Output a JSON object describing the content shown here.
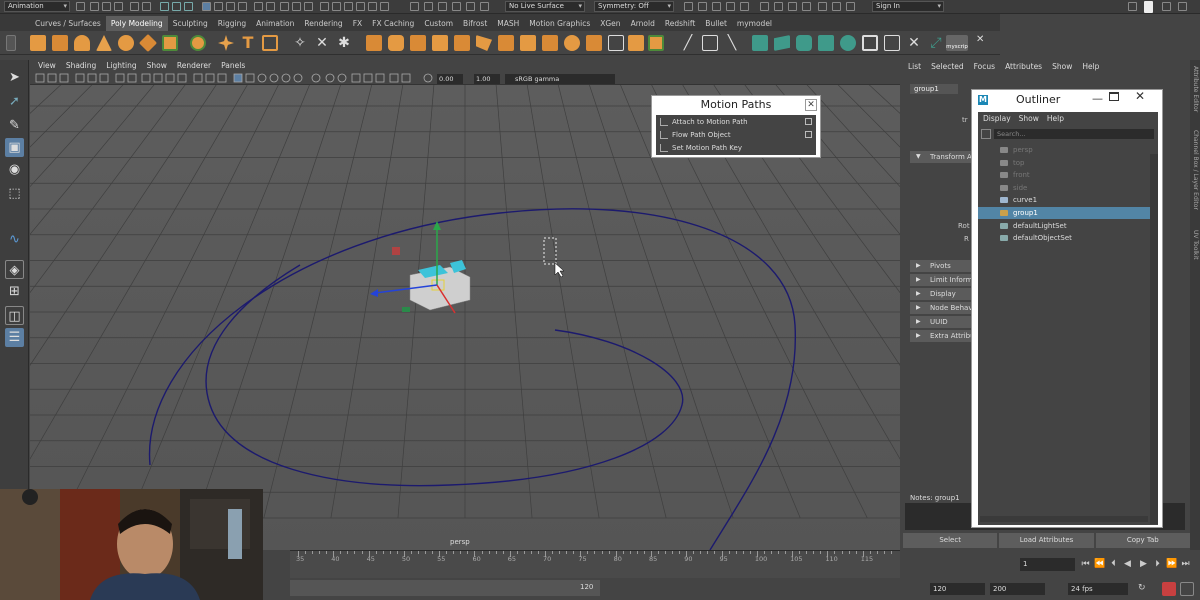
{
  "status_line": {
    "mode_menu": "Animation",
    "live_surface": "No Live Surface",
    "symmetry": "Symmetry: Off",
    "sign_in": "Sign In"
  },
  "shelf_tabs": [
    "Curves / Surfaces",
    "Poly Modeling",
    "Sculpting",
    "Rigging",
    "Animation",
    "Rendering",
    "FX",
    "FX Caching",
    "Custom",
    "Bifrost",
    "MASH",
    "Motion Graphics",
    "XGen",
    "Arnold",
    "Redshift",
    "Bullet",
    "mymodel"
  ],
  "shelf_active": "Poly Modeling",
  "shelf_custom_icon_label": "myscrip",
  "viewport": {
    "menus": [
      "View",
      "Shading",
      "Lighting",
      "Show",
      "Renderer",
      "Panels"
    ],
    "near_value": "0.00",
    "far_value": "1.00",
    "color_space": "sRGB gamma",
    "camera_label": "persp"
  },
  "motion_paths": {
    "title": "Motion Paths",
    "items": [
      "Attach to Motion Path",
      "Flow Path Object",
      "Set Motion Path Key"
    ]
  },
  "attribute_editor": {
    "menus": [
      "List",
      "Selected",
      "Focus",
      "Attributes",
      "Show",
      "Help"
    ],
    "node_tab": "group1",
    "partial_label_tr": "tr",
    "partial_label_rot": "Rot",
    "partial_label_r": "R",
    "sections": [
      "Transform A",
      "Pivots",
      "Limit Inform",
      "Display",
      "Node Behav",
      "UUID",
      "Extra Attribu"
    ],
    "notes_label": "Notes:  group1",
    "buttons": [
      "Select",
      "Load Attributes",
      "Copy Tab"
    ],
    "side_tabs": [
      "Attribute Editor",
      "Channel Box / Layer Editor",
      "UV Toolkit"
    ]
  },
  "outliner": {
    "title": "Outliner",
    "menus": [
      "Display",
      "Show",
      "Help"
    ],
    "search_placeholder": "Search...",
    "items": [
      {
        "label": "persp",
        "dim": true
      },
      {
        "label": "top",
        "dim": true
      },
      {
        "label": "front",
        "dim": true
      },
      {
        "label": "side",
        "dim": true
      },
      {
        "label": "curve1",
        "dim": false
      },
      {
        "label": "group1",
        "dim": false,
        "selected": true
      },
      {
        "label": "defaultLightSet",
        "dim": false
      },
      {
        "label": "defaultObjectSet",
        "dim": false
      }
    ]
  },
  "timeline": {
    "ticks": [
      "35",
      "40",
      "45",
      "50",
      "55",
      "60",
      "65",
      "70",
      "75",
      "80",
      "85",
      "90",
      "95",
      "100",
      "105",
      "110",
      "115"
    ],
    "current_frame": "1",
    "range_end": "120",
    "range_start_field": "120",
    "range_end_field": "200",
    "fps": "24 fps"
  },
  "colors": {
    "accent": "#5285a6",
    "curve": "#1c1a6e",
    "selected_tool": "#5c7fa3"
  }
}
